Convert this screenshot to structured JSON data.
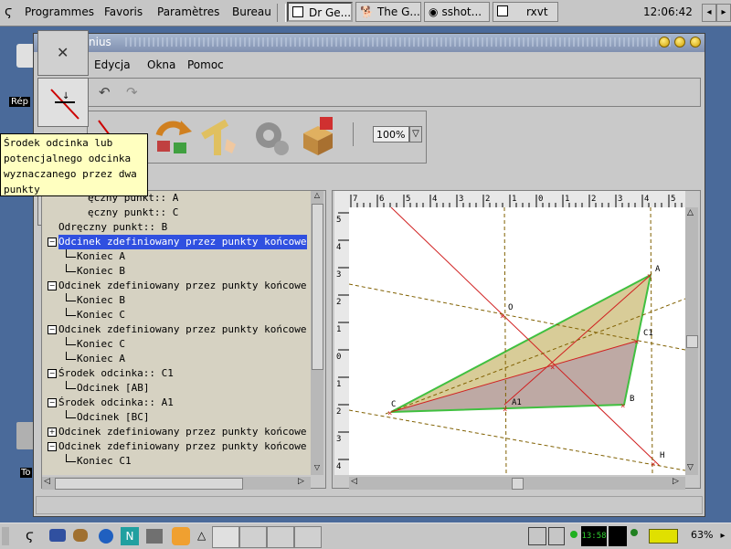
{
  "top_panel": {
    "menus": [
      "Programmes",
      "Favoris",
      "Paramètres",
      "Bureau"
    ],
    "tasks": [
      "Dr Ge...",
      "The G...",
      "sshot...",
      "rxvt"
    ],
    "clock": "12:06:42"
  },
  "desktop": {
    "icon_label": "Rép",
    "icon2_label": "To"
  },
  "window": {
    "title": "nius",
    "menu": [
      "Edycja",
      "Okna",
      "Pomoc"
    ],
    "zoom": "100%"
  },
  "tooltip": [
    "Środek odcinka lub",
    "potencjalnego odcinka",
    "wyznaczanego przez dwa",
    "punkty"
  ],
  "tree": {
    "rows": [
      "ęczny punkt:: A",
      "ęczny punkt:: C",
      "Odręczny punkt:: B",
      "Odcinek zdefiniowany przez punkty końcowe",
      "Koniec A",
      "Koniec B",
      "Odcinek zdefiniowany przez punkty końcowe",
      "Koniec B",
      "Koniec C",
      "Odcinek zdefiniowany przez punkty końcowe",
      "Koniec C",
      "Koniec A",
      "Środek odcinka:: C1",
      "Odcinek [AB]",
      "Środek odcinka:: A1",
      "Odcinek [BC]",
      "Odcinek zdefiniowany przez punkty końcowe",
      "Odcinek zdefiniowany przez punkty końcowe",
      "Koniec C1"
    ]
  },
  "ruler": {
    "top": [
      "7",
      "6",
      "5",
      "4",
      "3",
      "2",
      "1",
      "0",
      "1",
      "2",
      "3",
      "4",
      "5"
    ],
    "left": [
      "5",
      "4",
      "3",
      "2",
      "1",
      "0",
      "1",
      "2",
      "3",
      "4"
    ]
  },
  "points": [
    "A",
    "B",
    "C",
    "C1",
    "O",
    "H",
    "A1"
  ],
  "bottom_panel": {
    "battery": "63%",
    "mini_clock": "13:58"
  }
}
